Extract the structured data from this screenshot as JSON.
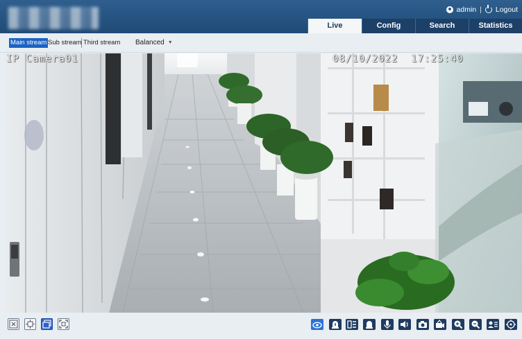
{
  "header": {
    "user": "admin",
    "separator": "|",
    "logout": "Logout",
    "tabs": [
      {
        "label": "Live",
        "active": true
      },
      {
        "label": "Config",
        "active": false
      },
      {
        "label": "Search",
        "active": false
      },
      {
        "label": "Statistics",
        "active": false
      }
    ]
  },
  "streams": {
    "main": "Main stream",
    "sub": "Sub stream",
    "third": "Third stream",
    "selected": "Main stream",
    "quality": "Balanced"
  },
  "video": {
    "camera_name": "IP Camera01",
    "timestamp": "08/10/2022  17:25:40"
  },
  "left_tools": [
    {
      "icon": "close-window-icon"
    },
    {
      "icon": "fit-window-icon"
    },
    {
      "icon": "window-layout-icon",
      "active": true
    },
    {
      "icon": "fullscreen-icon"
    }
  ],
  "right_tools": [
    {
      "icon": "eye-live-icon",
      "active": true
    },
    {
      "icon": "alarm-icon"
    },
    {
      "icon": "audio-alarm-icon"
    },
    {
      "icon": "alarm-output-icon"
    },
    {
      "icon": "microphone-icon"
    },
    {
      "icon": "speaker-icon"
    },
    {
      "icon": "snapshot-icon"
    },
    {
      "icon": "record-icon"
    },
    {
      "icon": "zoom-in-icon"
    },
    {
      "icon": "zoom-out-icon"
    },
    {
      "icon": "face-detection-icon"
    },
    {
      "icon": "ptz-icon"
    }
  ],
  "colors": {
    "header": "#24507e",
    "accent": "#1b63c4",
    "tab_dark": "#1c4068"
  }
}
